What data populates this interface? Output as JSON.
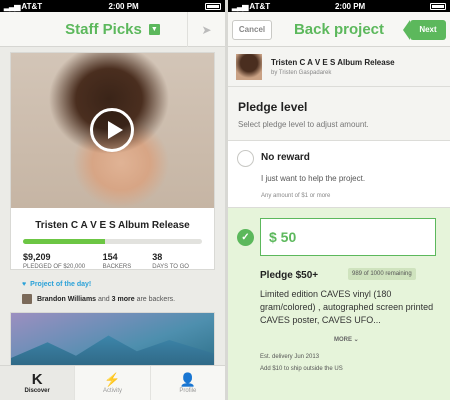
{
  "status_left": {
    "carrier": "AT&T",
    "time": "2:00 PM"
  },
  "status_right": {
    "carrier": "AT&T",
    "time": "2:00 PM"
  },
  "left": {
    "title": "Staff Picks",
    "project": {
      "title": "Tristen C A V E S Album Release",
      "funded_fraction": 0.46,
      "pledged": "$9,209",
      "pledged_label": "PLEDGED OF $20,000",
      "backers": "154",
      "backers_label": "BACKERS",
      "days": "38",
      "days_label": "DAYS TO GO"
    },
    "project_of_day": "Project of the day!",
    "backers_line": {
      "name": "Brandon Williams",
      "and": "and",
      "more": "3 more",
      "rest": "are backers."
    },
    "tabs": [
      {
        "label": "Discover",
        "icon": "K"
      },
      {
        "label": "Activity",
        "icon": "⚡"
      },
      {
        "label": "Profile",
        "icon": "👤"
      }
    ]
  },
  "right": {
    "cancel_label": "Cancel",
    "title": "Back project",
    "next_label": "Next",
    "project_title": "Tristen C A V E S Album Release",
    "project_by": "by Tristen Gaspadarek",
    "heading": "Pledge level",
    "subheading": "Select pledge level to adjust amount.",
    "no_reward": {
      "name": "No reward",
      "desc": "I just want to help the project.",
      "small": "Any amount of $1 or more"
    },
    "selected": {
      "amount": "$ 50",
      "name": "Pledge $50+",
      "remaining": "989 of 1000 remaining",
      "desc": "Limited edition CAVES vinyl (180 gram/colored) , autographed screen printed CAVES poster, CAVES UFO...",
      "more": "MORE ⌄",
      "delivery": "Est. delivery Jun 2013",
      "shipping": "Add $10 to ship outside the US"
    }
  }
}
